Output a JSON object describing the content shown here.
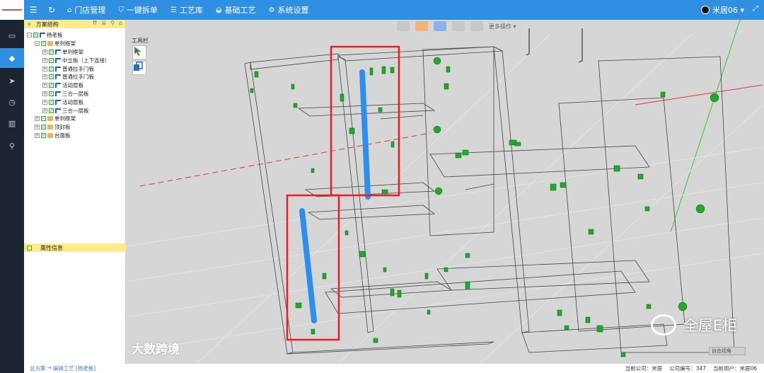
{
  "nav": {
    "items": [
      {
        "icon": "home-icon",
        "glyph": "⌂",
        "label": "门店管理"
      },
      {
        "icon": "shield-icon",
        "glyph": "⛉",
        "label": "一键拆单"
      },
      {
        "icon": "list-icon",
        "glyph": "☰",
        "label": "工艺库"
      },
      {
        "icon": "car-icon",
        "glyph": "◒",
        "label": "基础工艺"
      },
      {
        "icon": "gear-icon",
        "glyph": "⚙",
        "label": "系统设置"
      }
    ],
    "user": "米居06 ▾"
  },
  "tree": {
    "title": "方案结构",
    "rows": [
      {
        "indent": 0,
        "pm": "−",
        "icon": "part",
        "label": "杨老板"
      },
      {
        "indent": 1,
        "pm": "−",
        "icon": "folder",
        "label": "单列框架"
      },
      {
        "indent": 2,
        "pm": "+",
        "icon": "part",
        "label": "单列框架"
      },
      {
        "indent": 2,
        "pm": "+",
        "icon": "part",
        "label": "中立板（上下连接）"
      },
      {
        "indent": 2,
        "pm": "+",
        "icon": "part",
        "label": "普通拉手门板"
      },
      {
        "indent": 2,
        "pm": "+",
        "icon": "part",
        "label": "普通拉手门板"
      },
      {
        "indent": 2,
        "pm": "+",
        "icon": "part",
        "label": "活动层板"
      },
      {
        "indent": 2,
        "pm": "+",
        "icon": "part",
        "label": "三合一层板"
      },
      {
        "indent": 2,
        "pm": "+",
        "icon": "part",
        "label": "活动层板"
      },
      {
        "indent": 2,
        "pm": "+",
        "icon": "part",
        "label": "三合一层板"
      },
      {
        "indent": 1,
        "pm": "+",
        "icon": "folder",
        "label": "单列框架"
      },
      {
        "indent": 1,
        "pm": "+",
        "icon": "folder",
        "label": "顶封板"
      },
      {
        "indent": 1,
        "pm": "+",
        "icon": "folder",
        "label": "台面板"
      }
    ]
  },
  "properties": {
    "title": "属性信息"
  },
  "viewport": {
    "toolbox_label": "工具栏",
    "more_ops": "更多操作 ▾",
    "view_mode": "自由视角"
  },
  "watermarks": {
    "left": "大数跨境",
    "right": "全屋E柜"
  },
  "status": {
    "breadcrumb": [
      "总方案",
      "→",
      "编辑工艺",
      "[杨老板]"
    ],
    "company": "当前公司：米居",
    "company_id": "公司编号：347",
    "user": "当前用户：米居06"
  }
}
